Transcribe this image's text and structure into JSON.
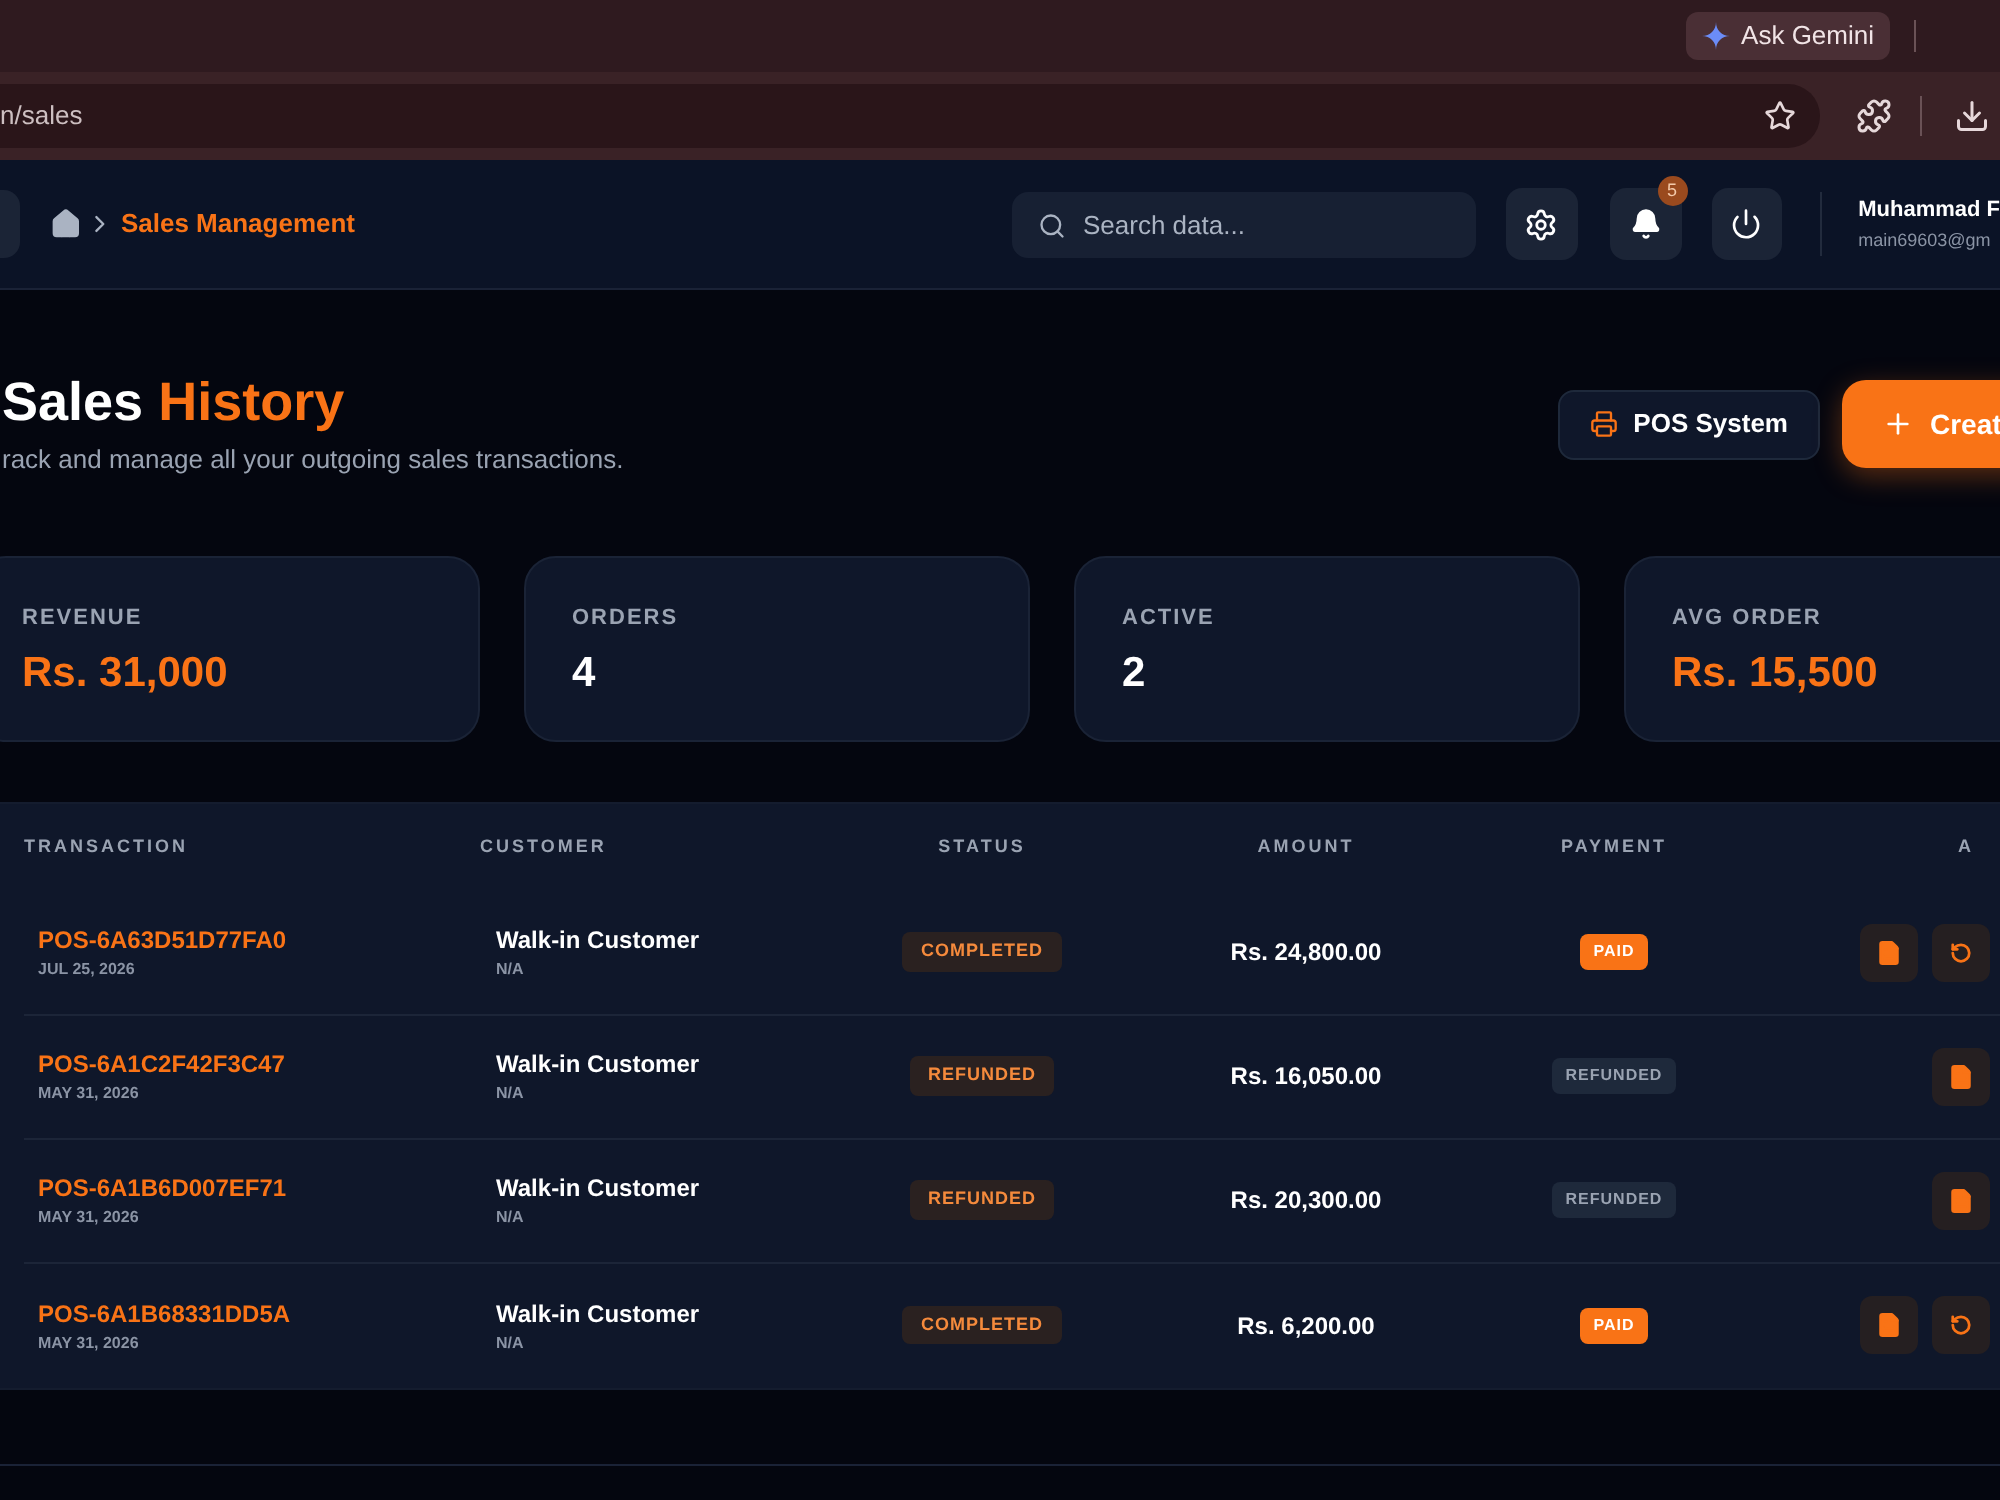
{
  "browser": {
    "gemini_button": "Ask Gemini",
    "url": "n/sales"
  },
  "header": {
    "breadcrumb": "Sales Management",
    "search": {
      "placeholder": "Search data..."
    },
    "notification_count": "5",
    "user": {
      "name": "Muhammad F",
      "email": "main69603@gm"
    }
  },
  "page": {
    "title": "Sales",
    "title_accent": "History",
    "subtitle": "rack and manage all your outgoing sales transactions.",
    "buttons": [
      {
        "label": "POS System",
        "kind": "pos"
      },
      {
        "label": "Creat",
        "kind": "create"
      }
    ]
  },
  "stats": [
    {
      "label": "REVENUE",
      "value": "Rs. 31,000",
      "accent": true
    },
    {
      "label": "ORDERS",
      "value": "4",
      "accent": false
    },
    {
      "label": "ACTIVE",
      "value": "2",
      "accent": false
    },
    {
      "label": "AVG ORDER",
      "value": "Rs. 15,500",
      "accent": true
    }
  ],
  "table": {
    "columns": [
      "TRANSACTION",
      "CUSTOMER",
      "STATUS",
      "AMOUNT",
      "PAYMENT",
      "A"
    ],
    "rows": [
      {
        "id": "POS-6A63D51D77FA0",
        "date": "JUL 25, 2026",
        "customer": "Walk-in Customer",
        "customer_detail": "N/A",
        "status": "COMPLETED",
        "amount": "Rs. 24,800.00",
        "payment": {
          "label": "PAID",
          "kind": "paid"
        },
        "actions": [
          {
            "kind": "invoice"
          },
          {
            "kind": "refund"
          }
        ]
      },
      {
        "id": "POS-6A1C2F42F3C47",
        "date": "MAY 31, 2026",
        "customer": "Walk-in Customer",
        "customer_detail": "N/A",
        "status": "REFUNDED",
        "amount": "Rs. 16,050.00",
        "payment": {
          "label": "REFUNDED",
          "kind": "refunded"
        },
        "actions": [
          {
            "kind": "invoice"
          }
        ]
      },
      {
        "id": "POS-6A1B6D007EF71",
        "date": "MAY 31, 2026",
        "customer": "Walk-in Customer",
        "customer_detail": "N/A",
        "status": "REFUNDED",
        "amount": "Rs. 20,300.00",
        "payment": {
          "label": "REFUNDED",
          "kind": "refunded"
        },
        "actions": [
          {
            "kind": "invoice"
          }
        ]
      },
      {
        "id": "POS-6A1B68331DD5A",
        "date": "MAY 31, 2026",
        "customer": "Walk-in Customer",
        "customer_detail": "N/A",
        "status": "COMPLETED",
        "amount": "Rs. 6,200.00",
        "payment": {
          "label": "PAID",
          "kind": "paid"
        },
        "actions": [
          {
            "kind": "invoice"
          },
          {
            "kind": "refund"
          }
        ]
      }
    ]
  }
}
